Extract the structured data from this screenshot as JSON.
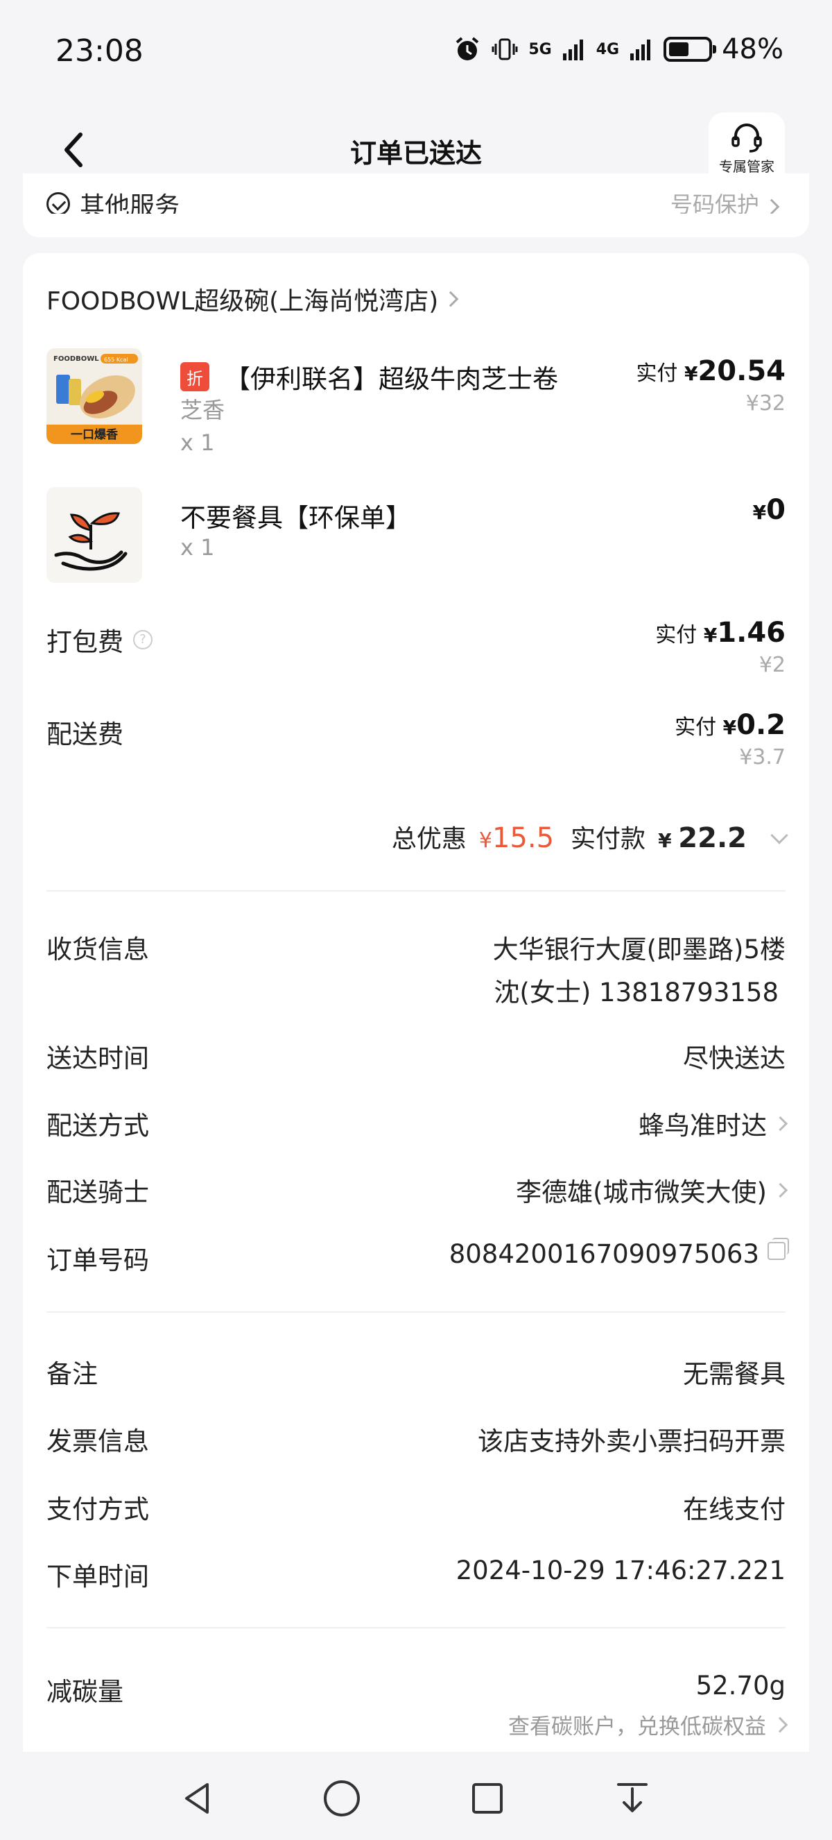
{
  "status_bar": {
    "time": "23:08",
    "net1": "5G",
    "net2": "4G",
    "battery": "48%"
  },
  "header": {
    "title": "订单已送达",
    "service_label": "专属管家"
  },
  "top_card": {
    "left": "其他服务",
    "right": "号码保护"
  },
  "store": {
    "name": "FOODBOWL超级碗(上海尚悦湾店)"
  },
  "items": [
    {
      "tag": "折",
      "name": "【伊利联名】超级牛肉芝士卷",
      "spec": "芝香",
      "qty": "x 1",
      "paid_label": "实付",
      "paid": "20.54",
      "original": "¥32",
      "thumb_brand": "FOODBOWL",
      "thumb_kcal": "655 Kcal",
      "thumb_slogan": "一口爆香"
    },
    {
      "name": "不要餐具【环保单】",
      "qty": "x 1",
      "paid": "0"
    }
  ],
  "fees": {
    "packing_label": "打包费",
    "packing_paid_label": "实付",
    "packing_paid": "1.46",
    "packing_original": "¥2",
    "delivery_label": "配送费",
    "delivery_paid_label": "实付",
    "delivery_paid": "0.2",
    "delivery_original": "¥3.7"
  },
  "total": {
    "discount_label": "总优惠",
    "discount_value": "15.5",
    "paid_label": "实付款",
    "paid_value": "22.2"
  },
  "info": {
    "receiver_label": "收货信息",
    "receiver_address": "大华银行大厦(即墨路)5楼",
    "receiver_contact": "沈(女士) 13818793158",
    "time_label": "送达时间",
    "time_value": "尽快送达",
    "method_label": "配送方式",
    "method_value": "蜂鸟准时达",
    "rider_label": "配送骑士",
    "rider_value": "李德雄(城市微笑大使)",
    "order_no_label": "订单号码",
    "order_no_value": "8084200167090975063",
    "remark_label": "备注",
    "remark_value": "无需餐具",
    "invoice_label": "发票信息",
    "invoice_value": "该店支持外卖小票扫码开票",
    "payment_label": "支付方式",
    "payment_value": "在线支付",
    "order_time_label": "下单时间",
    "order_time_value": "2024-10-29 17:46:27.221",
    "carbon_label": "减碳量",
    "carbon_value": "52.70g",
    "carbon_link": "查看碳账户，兑换低碳权益"
  },
  "colors": {
    "accent": "#e85a3a",
    "tag": "#ee4d3a",
    "background": "#f5f5f7"
  }
}
